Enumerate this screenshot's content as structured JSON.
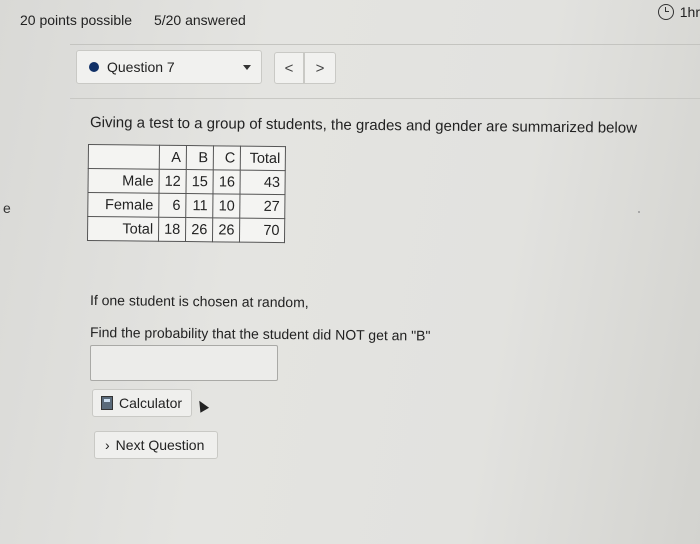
{
  "header": {
    "points": "20 points possible",
    "answered": "5/20 answered",
    "timer": "1hr"
  },
  "question_nav": {
    "selected": "Question 7",
    "prev_symbol": "<",
    "next_symbol": ">"
  },
  "question": {
    "prompt": "Giving a test to a group of students, the grades and gender are summarized below",
    "table": {
      "columns": [
        "",
        "A",
        "B",
        "C",
        "Total"
      ],
      "rows": [
        [
          "Male",
          "12",
          "15",
          "16",
          "43"
        ],
        [
          "Female",
          "6",
          "11",
          "10",
          "27"
        ],
        [
          "Total",
          "18",
          "26",
          "26",
          "70"
        ]
      ]
    },
    "line1": "If one student is chosen at random,",
    "line2": "Find the probability that the student did NOT get an \"B\"",
    "answer_value": ""
  },
  "buttons": {
    "calculator": "Calculator",
    "next_question": "Next Question"
  },
  "edge_text": "e",
  "icons": {
    "timer": "clock-icon",
    "calculator": "calculator-icon",
    "next": "chevron-right-icon"
  }
}
